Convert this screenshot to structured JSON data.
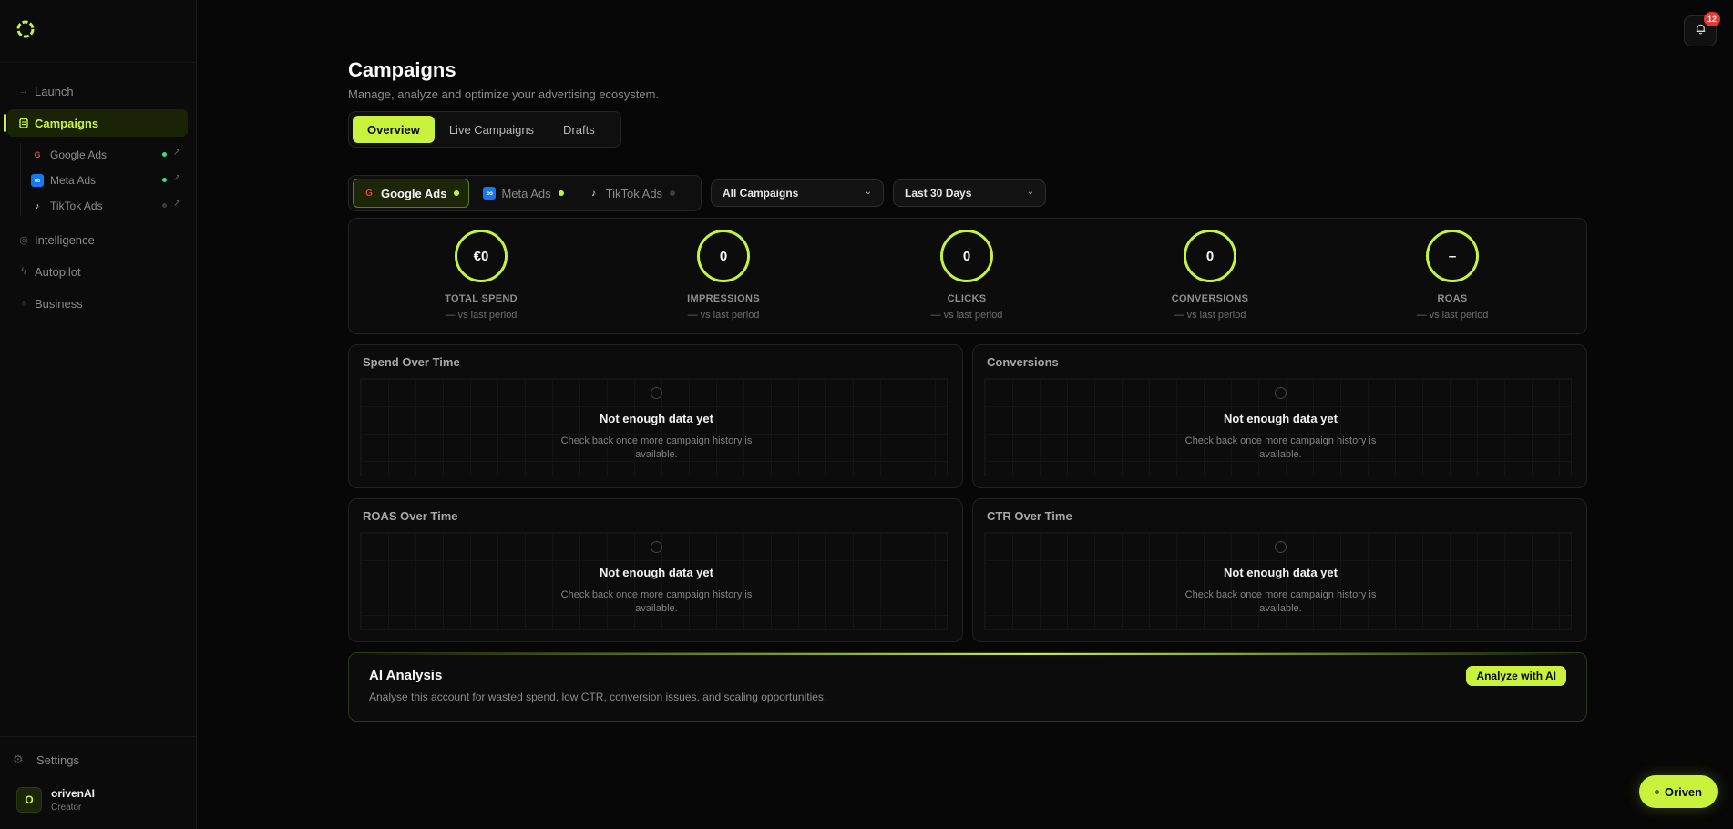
{
  "sidebar": {
    "nav": [
      {
        "label": "Launch",
        "icon": "arrow-right-icon"
      },
      {
        "label": "Campaigns",
        "icon": "clipboard-icon",
        "active": true
      },
      {
        "label": "Intelligence",
        "icon": "target-icon"
      },
      {
        "label": "Autopilot",
        "icon": "bolt-icon"
      },
      {
        "label": "Business",
        "icon": "lightbulb-icon"
      }
    ],
    "campaign_platforms": [
      {
        "label": "Google Ads",
        "status": "connected"
      },
      {
        "label": "Meta Ads",
        "status": "connected"
      },
      {
        "label": "TikTok Ads",
        "status": "disconnected"
      }
    ],
    "settings_label": "Settings",
    "user": {
      "initial": "O",
      "name": "orivenAI",
      "role": "Creator"
    }
  },
  "header": {
    "notification_count": "12",
    "title": "Campaigns",
    "subtitle": "Manage, analyze and optimize your advertising ecosystem."
  },
  "tabs": [
    {
      "label": "Overview",
      "active": true
    },
    {
      "label": "Live Campaigns"
    },
    {
      "label": "Drafts"
    }
  ],
  "platform_tabs": [
    {
      "label": "Google Ads",
      "active": true
    },
    {
      "label": "Meta Ads"
    },
    {
      "label": "TikTok Ads"
    }
  ],
  "filters": {
    "campaign_select": "All Campaigns",
    "date_select": "Last 30 Days"
  },
  "kpis": [
    {
      "value": "€0",
      "label": "TOTAL SPEND",
      "delta": "— vs last period"
    },
    {
      "value": "0",
      "label": "IMPRESSIONS",
      "delta": "— vs last period"
    },
    {
      "value": "0",
      "label": "CLICKS",
      "delta": "— vs last period"
    },
    {
      "value": "0",
      "label": "CONVERSIONS",
      "delta": "— vs last period"
    },
    {
      "value": "–",
      "label": "ROAS",
      "delta": "— vs last period"
    }
  ],
  "charts": [
    {
      "title": "Spend Over Time",
      "empty_title": "Not enough data yet",
      "empty_text": "Check back once more campaign history is available."
    },
    {
      "title": "Conversions",
      "empty_title": "Not enough data yet",
      "empty_text": "Check back once more campaign history is available."
    },
    {
      "title": "ROAS Over Time",
      "empty_title": "Not enough data yet",
      "empty_text": "Check back once more campaign history is available."
    },
    {
      "title": "CTR Over Time",
      "empty_title": "Not enough data yet",
      "empty_text": "Check back once more campaign history is available."
    }
  ],
  "ai_analysis": {
    "title": "AI Analysis",
    "text": "Analyse this account for wasted spend, low CTR, conversion issues, and scaling opportunities.",
    "button": "Analyze with AI"
  },
  "assistant_button": "Oriven",
  "colors": {
    "accent": "#c8f23c",
    "background": "#070707",
    "connected": "#3ddc84",
    "badge": "#e53935"
  }
}
